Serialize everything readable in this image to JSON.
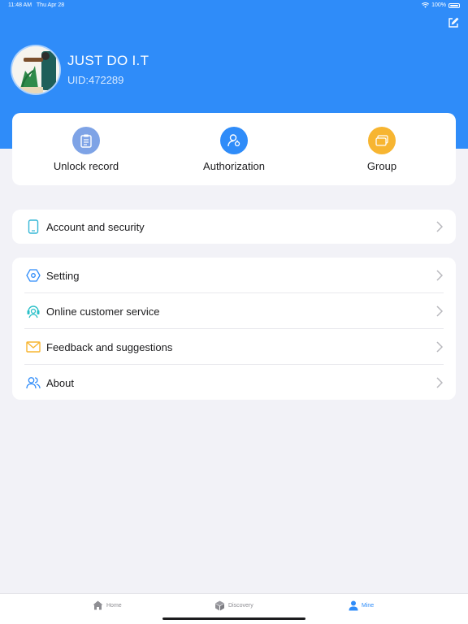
{
  "status_bar": {
    "time": "11:48 AM",
    "date": "Thu Apr 28",
    "battery": "100%"
  },
  "profile": {
    "name": "JUST DO I.T",
    "uid": "UID:472289"
  },
  "quick_actions": [
    {
      "label": "Unlock record",
      "icon": "clipboard-icon",
      "color": "#7EA3E6"
    },
    {
      "label": "Authorization",
      "icon": "user-key-icon",
      "color": "#2F8CF9"
    },
    {
      "label": "Group",
      "icon": "cards-icon",
      "color": "#F7B531"
    }
  ],
  "menu_account": [
    {
      "label": "Account and security",
      "icon": "tablet-icon",
      "color": "#35B7D6"
    }
  ],
  "menu_main": [
    {
      "label": "Setting",
      "icon": "hexagon-icon",
      "color": "#2F8CF9"
    },
    {
      "label": "Online customer service",
      "icon": "headset-icon",
      "color": "#2BC0C8"
    },
    {
      "label": "Feedback and suggestions",
      "icon": "envelope-icon",
      "color": "#F7B531"
    },
    {
      "label": "About",
      "icon": "users-icon",
      "color": "#2F8CF9"
    }
  ],
  "tabbar": {
    "home": "Home",
    "discovery": "Discovery",
    "mine": "Mine",
    "active": "Mine",
    "accent_color": "#2F8CF9"
  },
  "colors": {
    "header": "#2F8CF9",
    "background": "#F2F2F7"
  }
}
